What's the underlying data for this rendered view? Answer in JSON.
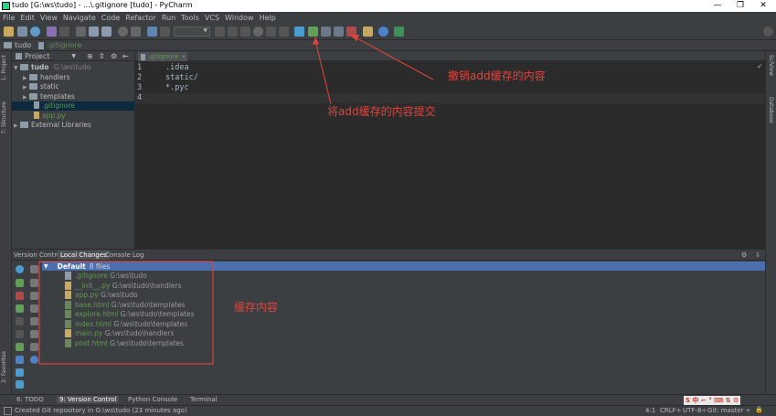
{
  "window": {
    "title": "tudo [G:\\ws\\tudo] - ...\\.gitignore [tudo] - PyCharm",
    "controls": [
      "—",
      "❐",
      "✕"
    ]
  },
  "menu": [
    "File",
    "Edit",
    "View",
    "Navigate",
    "Code",
    "Refactor",
    "Run",
    "Tools",
    "VCS",
    "Window",
    "Help"
  ],
  "breadcrumb": {
    "project": "tudo",
    "file": ".gitignore"
  },
  "project_panel": {
    "header": "Project",
    "tree": [
      {
        "label": "tudo",
        "path": "G:\\ws\\tudo",
        "depth": 0,
        "type": "folder",
        "expanded": true
      },
      {
        "label": "handlers",
        "path": "",
        "depth": 1,
        "type": "folder",
        "expanded": false
      },
      {
        "label": "static",
        "path": "",
        "depth": 1,
        "type": "folder",
        "expanded": false
      },
      {
        "label": "templates",
        "path": "",
        "depth": 1,
        "type": "folder",
        "expanded": false
      },
      {
        "label": ".gitignore",
        "path": "",
        "depth": 2,
        "type": "file",
        "selected": true
      },
      {
        "label": "app.py",
        "path": "",
        "depth": 2,
        "type": "file"
      },
      {
        "label": "External Libraries",
        "path": "",
        "depth": 0,
        "type": "lib",
        "expanded": false
      }
    ]
  },
  "left_stripe": {
    "project_tab": "1: Project",
    "structure_tab": "7: Structure",
    "favorites_tab": "2: Favorites"
  },
  "right_stripe": {
    "sciview_tab": "SciView",
    "database_tab": "Database"
  },
  "editor": {
    "tab": ".gitignore",
    "lines": [
      ".idea",
      "static/",
      "*.pyc",
      ""
    ]
  },
  "bottom_tabs": [
    "Version Control",
    "Local Changes",
    "Console",
    "Log"
  ],
  "changelist": {
    "header": "Default",
    "count": "8 files",
    "files": [
      {
        "name": ".gitignore",
        "path": "G:\\ws\\tudo"
      },
      {
        "name": "__init__.py",
        "path": "G:\\ws\\tudo\\handlers"
      },
      {
        "name": "app.py",
        "path": "G:\\ws\\tudo"
      },
      {
        "name": "base.html",
        "path": "G:\\ws\\tudo\\templates"
      },
      {
        "name": "explore.html",
        "path": "G:\\ws\\tudo\\templates"
      },
      {
        "name": "index.html",
        "path": "G:\\ws\\tudo\\templates"
      },
      {
        "name": "main.py",
        "path": "G:\\ws\\tudo\\handlers"
      },
      {
        "name": "post.html",
        "path": "G:\\ws\\tudo\\templates"
      }
    ]
  },
  "tool_windows": [
    "6: TODO",
    "9: Version Control",
    "Python Console",
    "Terminal"
  ],
  "status": {
    "message": "Created Git repository in G:\\ws\\tudo (23 minutes ago)",
    "position": "4:1",
    "line_sep": "CRLF÷",
    "encoding": "UTF-8÷",
    "vcs": "Git: master ÷"
  },
  "annotations": {
    "undo_add": "撤销add缓存的内容",
    "commit_add": "将add缓存的内容提交",
    "cache_content": "缓存内容"
  },
  "colors": {
    "annotation": "#e0433c",
    "selected": "#0d293e",
    "changelist_header": "#4b6eaf",
    "added_file": "#629755",
    "modified_file": "#6897bb"
  }
}
